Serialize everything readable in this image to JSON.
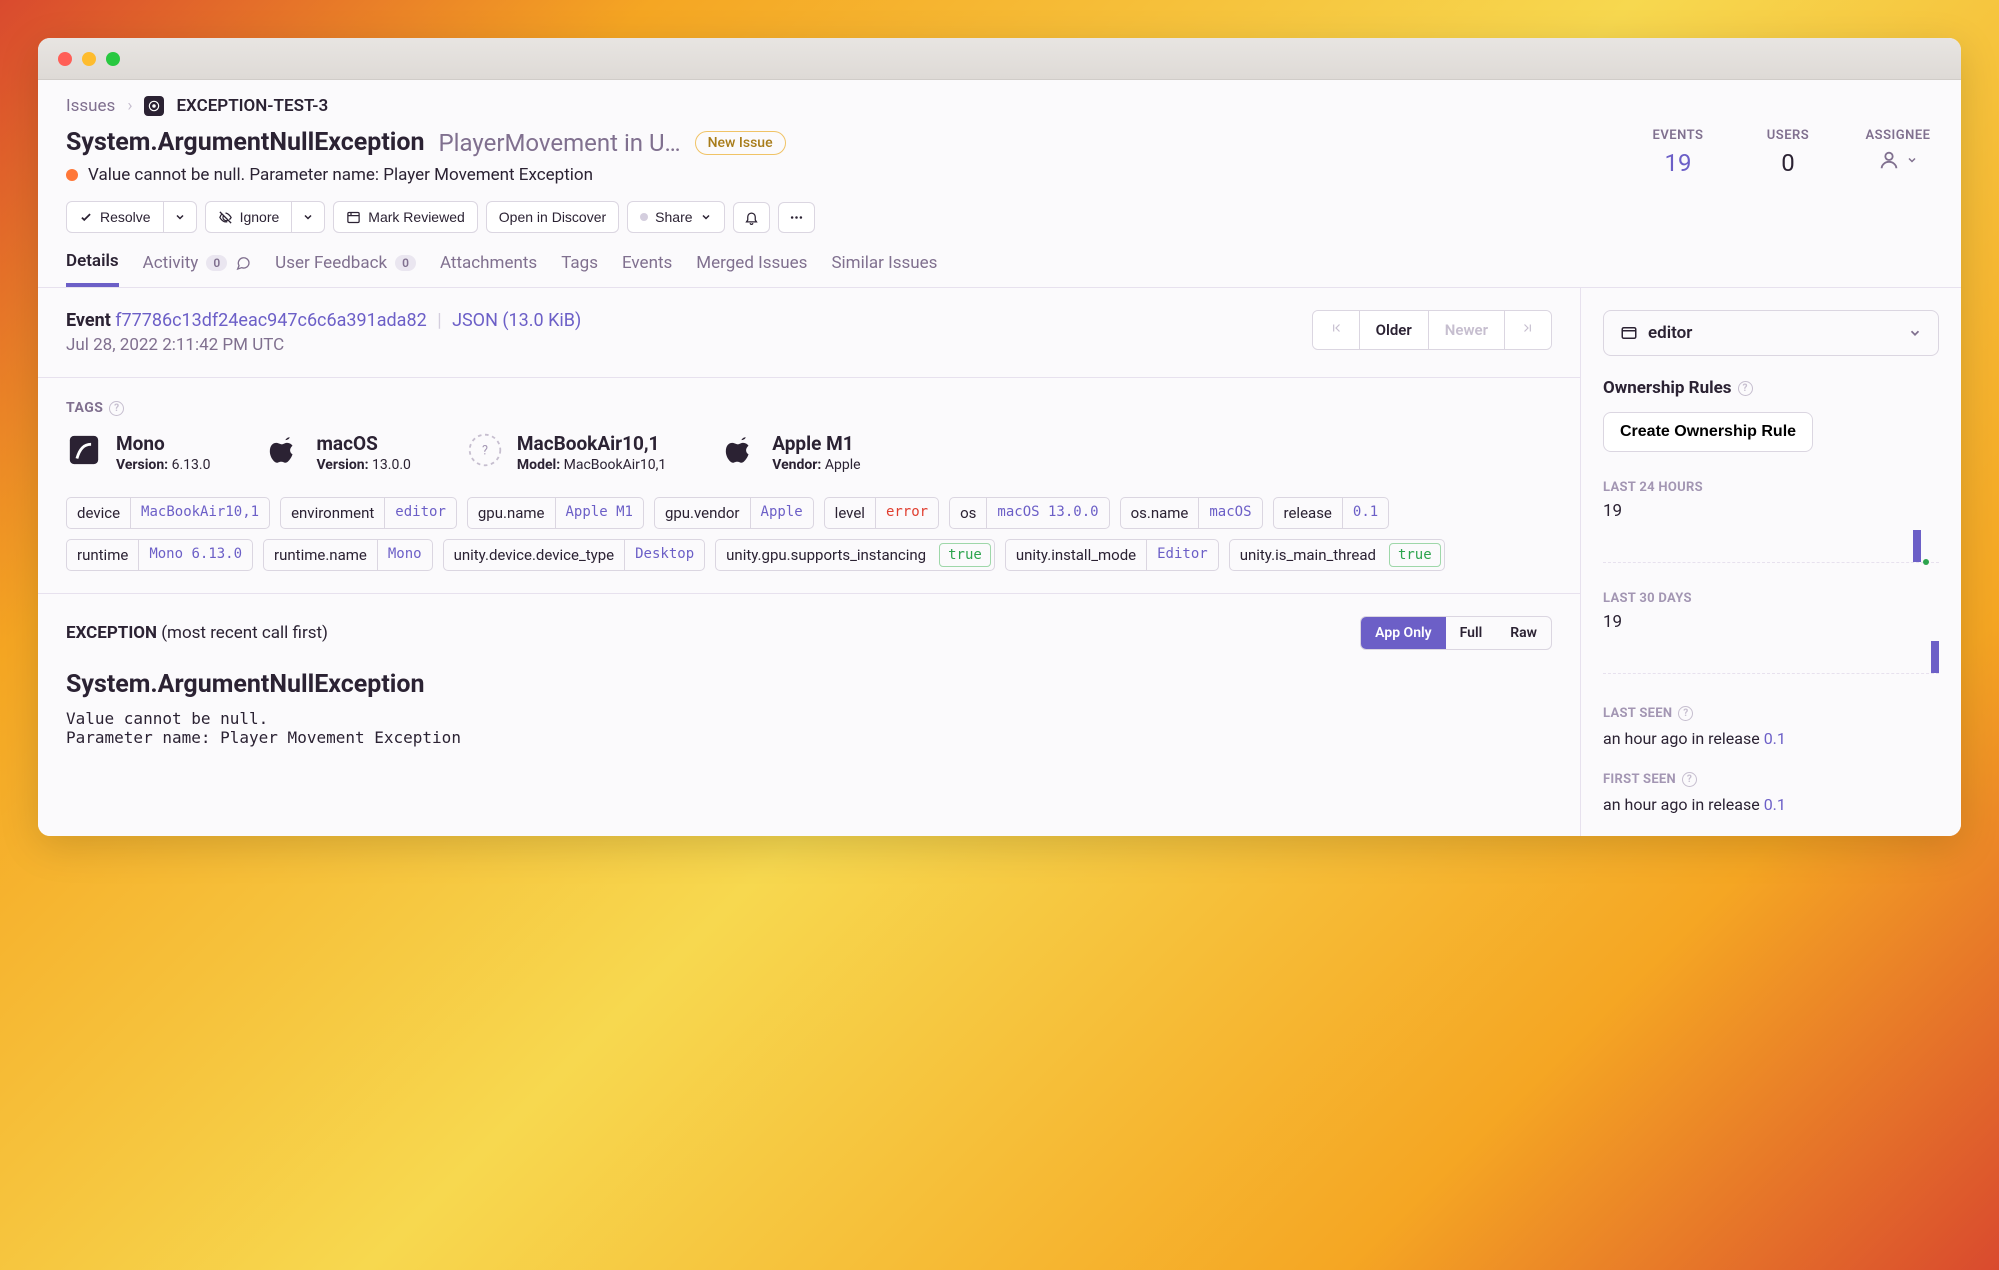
{
  "breadcrumbs": {
    "root": "Issues",
    "id": "EXCEPTION-TEST-3"
  },
  "issue": {
    "title": "System.ArgumentNullException",
    "subtitle": "PlayerMovement in U…",
    "badge": "New Issue",
    "message": "Value cannot be null. Parameter name: Player Movement Exception"
  },
  "stats": {
    "events_label": "EVENTS",
    "events": "19",
    "users_label": "USERS",
    "users": "0",
    "assignee_label": "ASSIGNEE"
  },
  "actions": {
    "resolve": "Resolve",
    "ignore": "Ignore",
    "mark_reviewed": "Mark Reviewed",
    "open_discover": "Open in Discover",
    "share": "Share"
  },
  "tabs": {
    "details": "Details",
    "activity": "Activity",
    "activity_n": "0",
    "user_feedback": "User Feedback",
    "user_feedback_n": "0",
    "attachments": "Attachments",
    "tags": "Tags",
    "events": "Events",
    "merged": "Merged Issues",
    "similar": "Similar Issues"
  },
  "event": {
    "label": "Event",
    "id": "f77786c13df24eac947c6c6a391ada82",
    "json": "JSON (13.0 KiB)",
    "date": "Jul 28, 2022 2:11:42 PM UTC",
    "older": "Older",
    "newer": "Newer"
  },
  "tags_section": {
    "title": "TAGS"
  },
  "contexts": [
    {
      "name": "Mono",
      "sub_k": "Version:",
      "sub_v": "6.13.0"
    },
    {
      "name": "macOS",
      "sub_k": "Version:",
      "sub_v": "13.0.0"
    },
    {
      "name": "MacBookAir10,1",
      "sub_k": "Model:",
      "sub_v": "MacBookAir10,1"
    },
    {
      "name": "Apple M1",
      "sub_k": "Vendor:",
      "sub_v": "Apple"
    }
  ],
  "tags": [
    {
      "k": "device",
      "v": "MacBookAir10,1"
    },
    {
      "k": "environment",
      "v": "editor"
    },
    {
      "k": "gpu.name",
      "v": "Apple M1"
    },
    {
      "k": "gpu.vendor",
      "v": "Apple"
    },
    {
      "k": "level",
      "v": "error",
      "cls": "red"
    },
    {
      "k": "os",
      "v": "macOS 13.0.0"
    },
    {
      "k": "os.name",
      "v": "macOS"
    },
    {
      "k": "release",
      "v": "0.1"
    },
    {
      "k": "runtime",
      "v": "Mono 6.13.0"
    },
    {
      "k": "runtime.name",
      "v": "Mono"
    },
    {
      "k": "unity.device.device_type",
      "v": "Desktop"
    },
    {
      "k": "unity.gpu.supports_instancing",
      "v": "true",
      "cls": "green"
    },
    {
      "k": "unity.install_mode",
      "v": "Editor"
    },
    {
      "k": "unity.is_main_thread",
      "v": "true",
      "cls": "green"
    }
  ],
  "exception": {
    "heading": "EXCEPTION",
    "hint": "(most recent call first)",
    "toggle": {
      "app": "App Only",
      "full": "Full",
      "raw": "Raw"
    },
    "type": "System.ArgumentNullException",
    "msg": "Value cannot be null.\nParameter name: Player Movement Exception"
  },
  "sidebar": {
    "env": "editor",
    "ownership_title": "Ownership Rules",
    "create_rule": "Create Ownership Rule",
    "last24_label": "LAST 24 HOURS",
    "last24_n": "19",
    "last30_label": "LAST 30 DAYS",
    "last30_n": "19",
    "last_seen_label": "LAST SEEN",
    "last_seen": "an hour ago",
    "last_seen_in": "in release ",
    "last_seen_rel": "0.1",
    "first_seen_label": "FIRST SEEN",
    "first_seen": "an hour ago",
    "first_seen_in": "in release ",
    "first_seen_rel": "0.1"
  }
}
